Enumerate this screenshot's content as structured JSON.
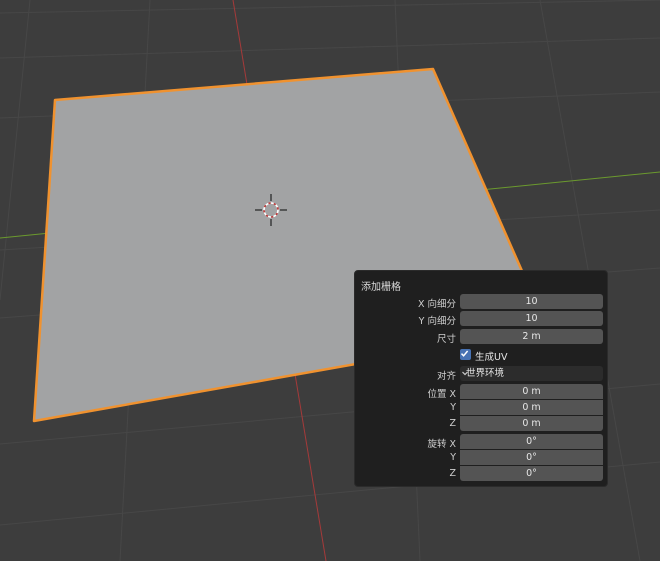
{
  "viewport": {
    "background": "#3d3d3d",
    "plane_color": "#a2a3a4",
    "outline_color": "#f0922f",
    "x_axis_color": "#a53a3a",
    "y_axis_color": "#6b9a2e",
    "icons": [
      "3d-cursor-icon"
    ]
  },
  "panel": {
    "title": "添加栅格",
    "x_subdiv": {
      "label": "X 向细分",
      "value": "10"
    },
    "y_subdiv": {
      "label": "Y 向细分",
      "value": "10"
    },
    "size": {
      "label": "尺寸",
      "value": "2 m"
    },
    "generate_uv": {
      "label": "生成UV",
      "checked": true
    },
    "align": {
      "label": "对齐",
      "value": "世界环境"
    },
    "location": {
      "label_x": "位置 X",
      "label_y": "Y",
      "label_z": "Z",
      "x": "0 m",
      "y": "0 m",
      "z": "0 m"
    },
    "rotation": {
      "label_x": "旋转 X",
      "label_y": "Y",
      "label_z": "Z",
      "x": "0°",
      "y": "0°",
      "z": "0°"
    },
    "accent_color": "#4772b3"
  }
}
